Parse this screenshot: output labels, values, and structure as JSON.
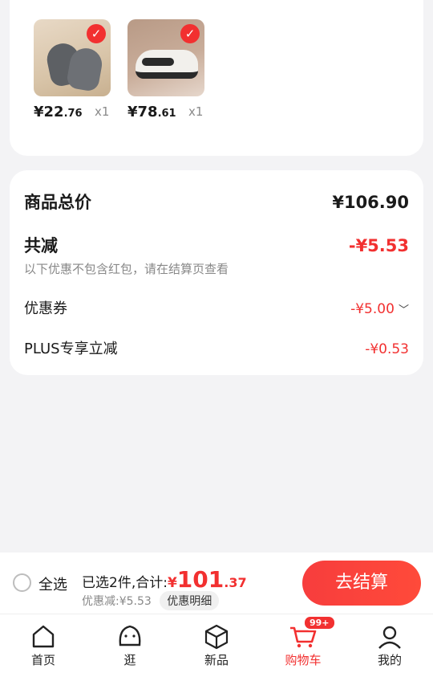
{
  "products": [
    {
      "price_int": "¥22",
      "price_dec": ".76",
      "qty": "x1",
      "check": "✓"
    },
    {
      "price_int": "¥78",
      "price_dec": ".61",
      "qty": "x1",
      "check": "✓"
    }
  ],
  "summary": {
    "total_label": "商品总价",
    "total_value": "¥106.90",
    "reduction_label": "共减",
    "reduction_value": "-¥5.53",
    "note": "以下优惠不包含红包，请在结算页查看",
    "coupon_label": "优惠券",
    "coupon_value": "-¥5.00",
    "plus_label": "PLUS专享立减",
    "plus_value": "-¥0.53"
  },
  "footer": {
    "select_all": "全选",
    "selected_text": "已选2件,合计:",
    "total_currency": "¥",
    "total_int": "101",
    "total_dec": ".37",
    "discount_text": "优惠减:¥5.53",
    "detail_label": "优惠明细",
    "checkout_label": "去结算"
  },
  "tabs": [
    {
      "label": "首页",
      "icon": "home-icon"
    },
    {
      "label": "逛",
      "icon": "explore-icon"
    },
    {
      "label": "新品",
      "icon": "new-products-icon"
    },
    {
      "label": "购物车",
      "icon": "cart-icon",
      "badge": "99+"
    },
    {
      "label": "我的",
      "icon": "profile-icon"
    }
  ],
  "colors": {
    "accent": "#f23030",
    "background": "#f3f3f5"
  }
}
